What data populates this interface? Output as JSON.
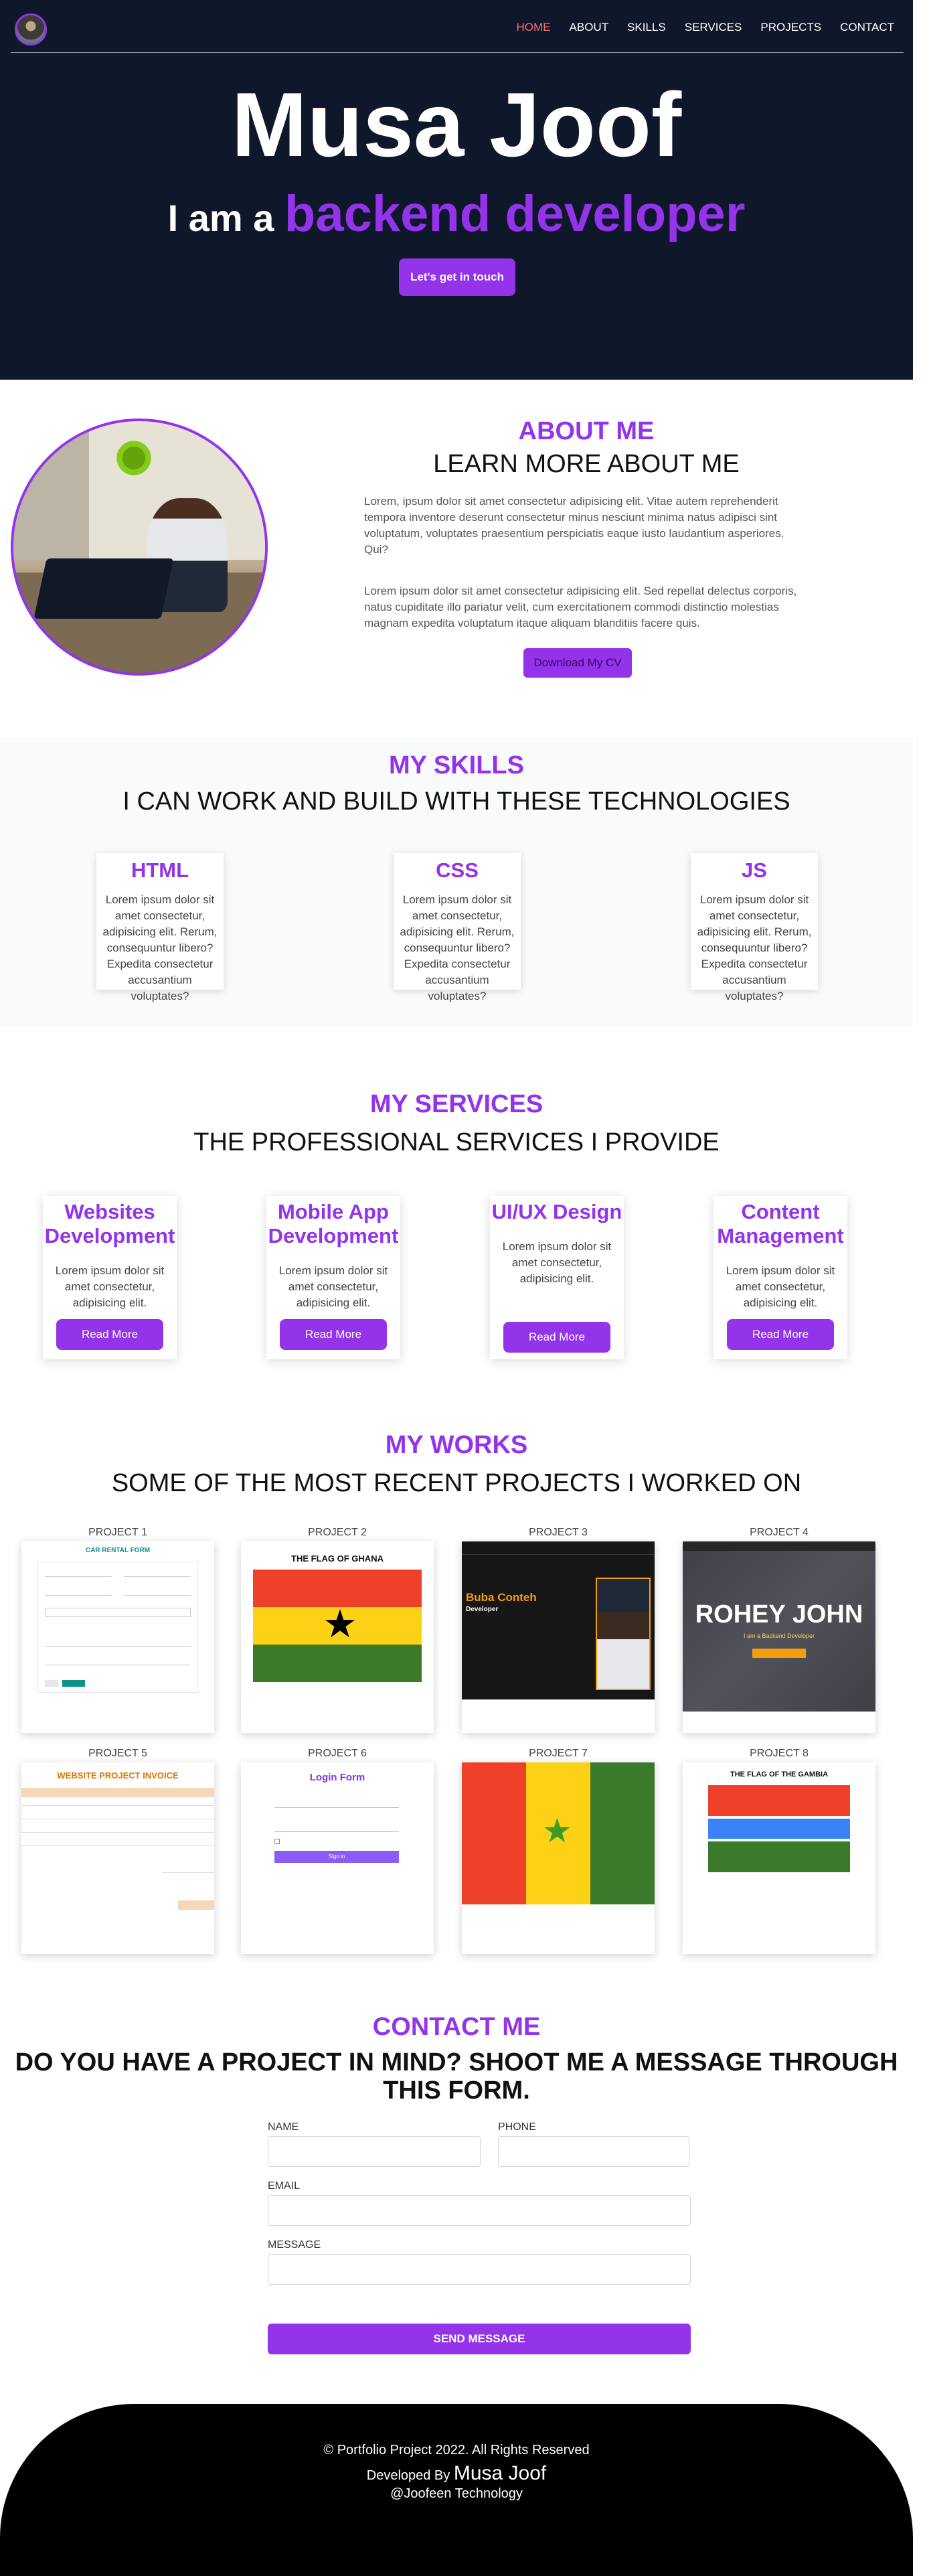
{
  "nav": {
    "links": [
      "HOME",
      "ABOUT",
      "SKILLS",
      "SERVICES",
      "PROJECTS",
      "CONTACT"
    ],
    "active": "HOME"
  },
  "hero": {
    "name": "Musa Joof",
    "role_prefix": "I am a",
    "role_highlight": "backend developer",
    "cta": "Let's get in touch"
  },
  "about": {
    "kicker": "ABOUT ME",
    "title": "LEARN MORE ABOUT ME",
    "paragraphs": [
      "Lorem, ipsum dolor sit amet consectetur adipisicing elit. Vitae autem reprehenderit tempora inventore deserunt consectetur minus nesciunt minima natus adipisci sint voluptatum, voluptates praesentium perspiciatis eaque iusto laudantium asperiores. Qui?",
      "Lorem ipsum dolor sit amet consectetur adipisicing elit. Sed repellat delectus corporis, natus cupiditate illo pariatur velit, cum exercitationem commodi distinctio molestias magnam expedita voluptatum itaque aliquam blanditiis facere quis."
    ],
    "cv_button": "Download My CV"
  },
  "skills": {
    "kicker": "MY SKILLS",
    "title": "I CAN WORK AND BUILD WITH THESE TECHNOLOGIES",
    "items": [
      {
        "name": "HTML",
        "text": "Lorem ipsum dolor sit amet consectetur, adipisicing elit. Rerum, consequuntur libero? Expedita consectetur accusantium voluptates?"
      },
      {
        "name": "CSS",
        "text": "Lorem ipsum dolor sit amet consectetur, adipisicing elit. Rerum, consequuntur libero? Expedita consectetur accusantium voluptates?"
      },
      {
        "name": "JS",
        "text": "Lorem ipsum dolor sit amet consectetur, adipisicing elit. Rerum, consequuntur libero? Expedita consectetur accusantium voluptates?"
      }
    ]
  },
  "services": {
    "kicker": "MY SERVICES",
    "title": "THE PROFESSIONAL SERVICES I PROVIDE",
    "items": [
      {
        "name": "Websites Development",
        "text": "Lorem ipsum dolor sit amet consectetur, adipisicing elit.",
        "button": "Read More"
      },
      {
        "name": "Mobile App Development",
        "text": "Lorem ipsum dolor sit amet consectetur, adipisicing elit.",
        "button": "Read More"
      },
      {
        "name": "UI/UX Design",
        "text": "Lorem ipsum dolor sit amet consectetur, adipisicing elit.",
        "button": "Read More"
      },
      {
        "name": "Content Management",
        "text": "Lorem ipsum dolor sit amet consectetur, adipisicing elit.",
        "button": "Read More"
      }
    ]
  },
  "works": {
    "kicker": "MY WORKS",
    "title": "SOME OF THE MOST RECENT PROJECTS I WORKED ON",
    "projects": [
      {
        "label": "PROJECT 1",
        "heading": "CAR RENTAL FORM"
      },
      {
        "label": "PROJECT 2",
        "heading": "THE FLAG OF GHANA"
      },
      {
        "label": "PROJECT 3",
        "heading": "Buba Conteh",
        "sub": "Developer"
      },
      {
        "label": "PROJECT 4",
        "heading": "ROHEY JOHN",
        "sub": "I am a Backend Developer"
      },
      {
        "label": "PROJECT 5",
        "heading": "WEBSITE PROJECT INVOICE"
      },
      {
        "label": "PROJECT 6",
        "heading": "Login Form",
        "button": "Sign in"
      },
      {
        "label": "PROJECT 7"
      },
      {
        "label": "PROJECT 8",
        "heading": "THE FLAG OF THE GAMBIA"
      }
    ]
  },
  "contact": {
    "kicker": "CONTACT ME",
    "title": "DO YOU HAVE A PROJECT IN MIND? SHOOT ME A MESSAGE THROUGH THIS FORM.",
    "labels": {
      "name": "NAME",
      "phone": "PHONE",
      "email": "EMAIL",
      "message": "MESSAGE"
    },
    "button": "SEND MESSAGE"
  },
  "footer": {
    "copyright": "© Portfolio Project 2022. All Rights Reserved",
    "developed_by": "Developed By",
    "author": "Musa Joof",
    "company": "@Joofeen Technology"
  },
  "colors": {
    "accent": "#9333ea",
    "hero_bg": "#0f172a",
    "active_nav": "#f87171"
  }
}
